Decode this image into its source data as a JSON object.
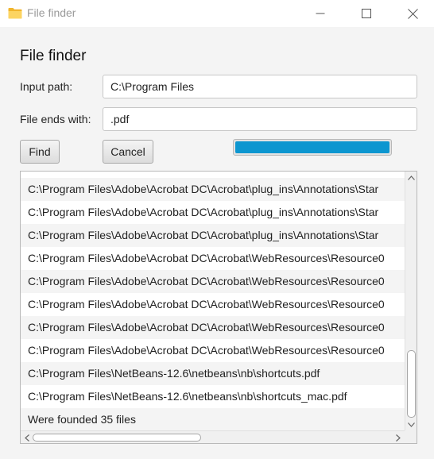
{
  "window": {
    "title": "File finder",
    "icon": "folder-icon",
    "minimize_icon": "minimize-icon",
    "maximize_icon": "maximize-icon",
    "close_icon": "close-icon"
  },
  "form": {
    "heading": "File finder",
    "input_path_label": "Input path:",
    "input_path_value": "C:\\Program Files",
    "ends_with_label": "File ends with:",
    "ends_with_value": ".pdf",
    "find_label": "Find",
    "cancel_label": "Cancel",
    "progress": 1.0,
    "progress_color": "#0c96d0"
  },
  "results": {
    "items": [
      "C:\\Program Files\\Adobe\\Acrobat DC\\Acrobat\\plug_ins\\Annotations\\Star",
      "C:\\Program Files\\Adobe\\Acrobat DC\\Acrobat\\plug_ins\\Annotations\\Star",
      "C:\\Program Files\\Adobe\\Acrobat DC\\Acrobat\\plug_ins\\Annotations\\Star",
      "C:\\Program Files\\Adobe\\Acrobat DC\\Acrobat\\WebResources\\Resource0",
      "C:\\Program Files\\Adobe\\Acrobat DC\\Acrobat\\WebResources\\Resource0",
      "C:\\Program Files\\Adobe\\Acrobat DC\\Acrobat\\WebResources\\Resource0",
      "C:\\Program Files\\Adobe\\Acrobat DC\\Acrobat\\WebResources\\Resource0",
      "C:\\Program Files\\Adobe\\Acrobat DC\\Acrobat\\WebResources\\Resource0",
      "C:\\Program Files\\NetBeans-12.6\\netbeans\\nb\\shortcuts.pdf",
      "C:\\Program Files\\NetBeans-12.6\\netbeans\\nb\\shortcuts_mac.pdf",
      "Were founded 35 files"
    ]
  }
}
